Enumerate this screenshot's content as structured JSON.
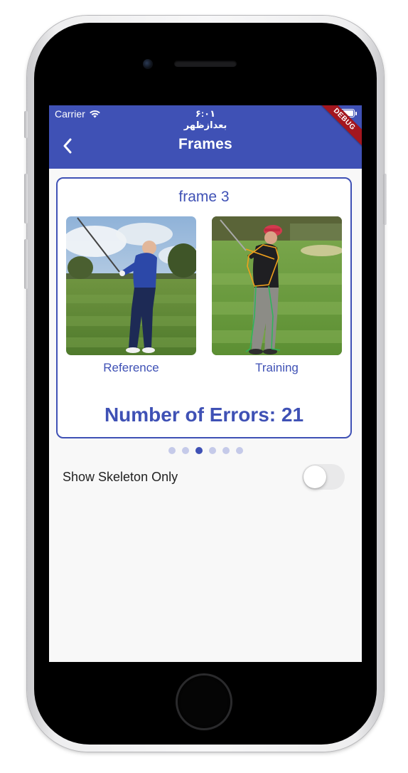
{
  "status_bar": {
    "carrier": "Carrier",
    "time": "۶:۰۱ بعدازظهر",
    "debug_badge": "DEBUG"
  },
  "app_bar": {
    "title": "Frames",
    "back_icon": "chevron-left-icon"
  },
  "frame_card": {
    "title": "frame 3",
    "reference_label": "Reference",
    "training_label": "Training",
    "errors_text": "Number of Errors: 21"
  },
  "pager": {
    "count": 6,
    "active_index": 2
  },
  "settings": {
    "show_skeleton_label": "Show Skeleton Only",
    "show_skeleton_value": false
  },
  "colors": {
    "primary": "#3f51b5",
    "primary_light": "#c5cae9",
    "debug_ribbon": "#a3161f"
  }
}
